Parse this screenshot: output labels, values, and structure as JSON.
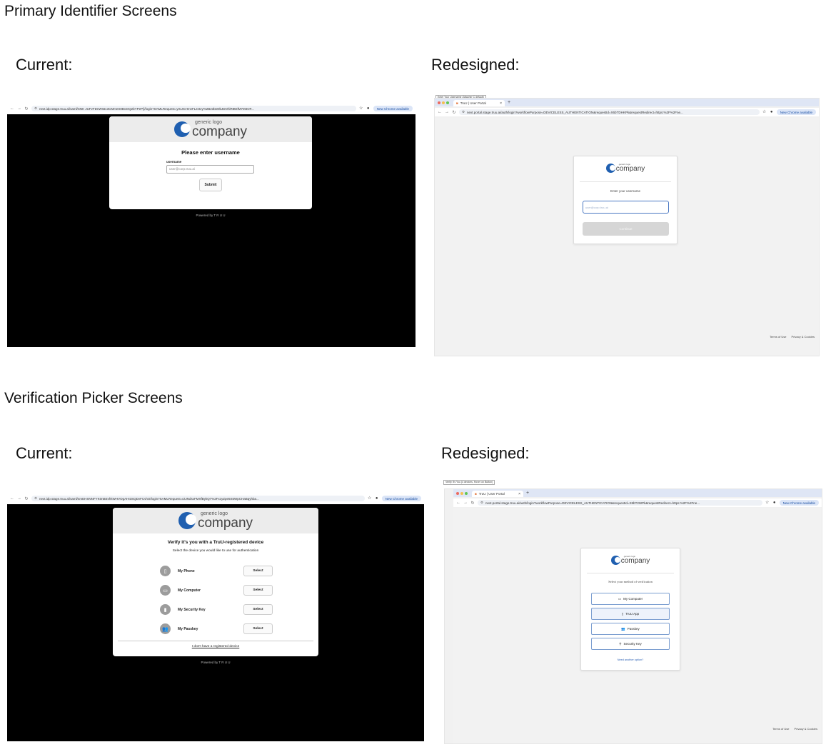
{
  "sections": {
    "primary_title": "Primary Identifier Screens",
    "verification_title": "Verification Picker Screens",
    "current_label": "Current:",
    "redesigned_label": "Redesigned:"
  },
  "logo": {
    "small": "generic logo",
    "big": "company"
  },
  "browser": {
    "new_chrome": "New Chrome available",
    "tab_title": "TruU | User Portal"
  },
  "primary_current": {
    "url": "next.idp.stage.truu.ai/saml/SNK JUFvFDnWs6c3CMmeS0Bv3rQ2bYPeP/j/login?SAMLRequest=yXL9cHmvFLzntzy%2B23bD0bJDOhiR8tEfM7M4OF...",
    "heading": "Please enter username",
    "field_label": "username",
    "field_placeholder": "user@corp.truu.ai",
    "submit": "Submit",
    "powered_by": "Powered by",
    "brand": "T R U U"
  },
  "primary_redesigned": {
    "tooltip": "Enter Your Username (Attacher C default)",
    "url": "next.portal.stage.truu.ai/auth/login?workflowPurpose=DEVICELESS_AUTHENTICATION&requestId=X6bTDHKPk&requestRedirect=https:%2F%2Fne...",
    "subtitle": "Enter your username",
    "field_placeholder": "user@corp.truu.ai",
    "continue": "Continue",
    "terms": "Terms of Use",
    "privacy": "Privacy & Cookies"
  },
  "verify_current": {
    "url": "next.idp.stage.truu.ai/saml/4mEHSNNFYK0nBEvhkWHVOgAHI3SQDvFCvhO/login?SAMLRequest=rZJNdsxFMXfBykQ7%2FxzyZpe5S5WpCHaBqyhba...",
    "heading": "Verify it's you with a TruU-registered device",
    "subtitle": "Select the device you would like to use for authentication",
    "devices": [
      {
        "label": "My Phone",
        "icon": "phone-icon",
        "glyph": "▯"
      },
      {
        "label": "My Computer",
        "icon": "laptop-icon",
        "glyph": "▭"
      },
      {
        "label": "My Security Key",
        "icon": "security-key-icon",
        "glyph": "▮"
      },
      {
        "label": "My Passkey",
        "icon": "passkey-icon",
        "glyph": "👥"
      }
    ],
    "select_label": "Select",
    "no_device_link": "I don't have a registered device",
    "powered_by": "Powered by",
    "brand": "T R U U"
  },
  "verify_redesigned": {
    "tooltip": "Verify It's You (4 devices, Hover on Button)",
    "url": "next.portal.stage.truu.ai/auth/login?workflowPurpose=DEVICELESS_AUTHENTICATION&requestId=X8bT2WPk&requestRedirect=https:%2F%2Fne...",
    "subtitle": "Select your method of verification",
    "methods": [
      {
        "label": "My Computer",
        "icon": "computer-icon",
        "glyph": "▭",
        "selected": false
      },
      {
        "label": "TruU App",
        "icon": "phone-icon",
        "glyph": "▯",
        "selected": true
      },
      {
        "label": "Passkey",
        "icon": "passkey-icon",
        "glyph": "👥",
        "selected": false
      },
      {
        "label": "Security Key",
        "icon": "security-key-icon",
        "glyph": "⚲",
        "selected": false
      }
    ],
    "need_another": "Need another option?",
    "terms": "Terms of Use",
    "privacy": "Privacy & Cookies"
  }
}
